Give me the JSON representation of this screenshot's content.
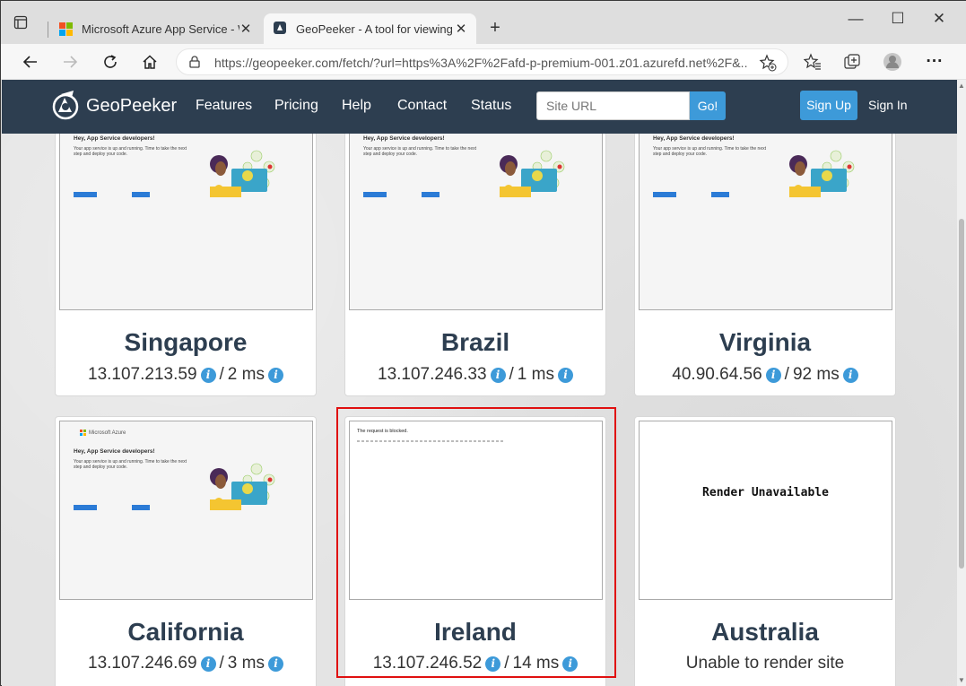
{
  "browser": {
    "tabs": [
      {
        "title": "Microsoft Azure App Service - W",
        "active": false
      },
      {
        "title": "GeoPeeker - A tool for viewing s",
        "active": true
      }
    ],
    "url": "https://geopeeker.com/fetch/?url=https%3A%2F%2Fafd-p-premium-001.z01.azurefd.net%2F&..."
  },
  "navbar": {
    "brand": "GeoPeeker",
    "links": [
      "Features",
      "Pricing",
      "Help",
      "Contact",
      "Status"
    ],
    "site_url_placeholder": "Site URL",
    "go_label": "Go!",
    "signup_label": "Sign Up",
    "signin_label": "Sign In"
  },
  "preview": {
    "ms_brand": "Microsoft Azure",
    "heading": "Hey, App Service developers!",
    "body": "Your app service is up and running. Time to take the next step and deploy your code.",
    "blocked_message": "The request is blocked.",
    "render_unavailable": "Render Unavailable"
  },
  "locations": [
    {
      "name": "Singapore",
      "ip": "13.107.213.59",
      "latency": "2 ms",
      "status": "rendered"
    },
    {
      "name": "Brazil",
      "ip": "13.107.246.33",
      "latency": "1 ms",
      "status": "rendered"
    },
    {
      "name": "Virginia",
      "ip": "40.90.64.56",
      "latency": "92 ms",
      "status": "rendered"
    },
    {
      "name": "California",
      "ip": "13.107.246.69",
      "latency": "3 ms",
      "status": "rendered"
    },
    {
      "name": "Ireland",
      "ip": "13.107.246.52",
      "latency": "14 ms",
      "status": "blocked",
      "highlighted": true
    },
    {
      "name": "Australia",
      "ip": "",
      "latency": "",
      "status": "unavailable",
      "message": "Unable to render site"
    }
  ],
  "colors": {
    "navbar": "#2d3e50",
    "accent": "#3d9ad9",
    "highlight": "#e01010"
  }
}
